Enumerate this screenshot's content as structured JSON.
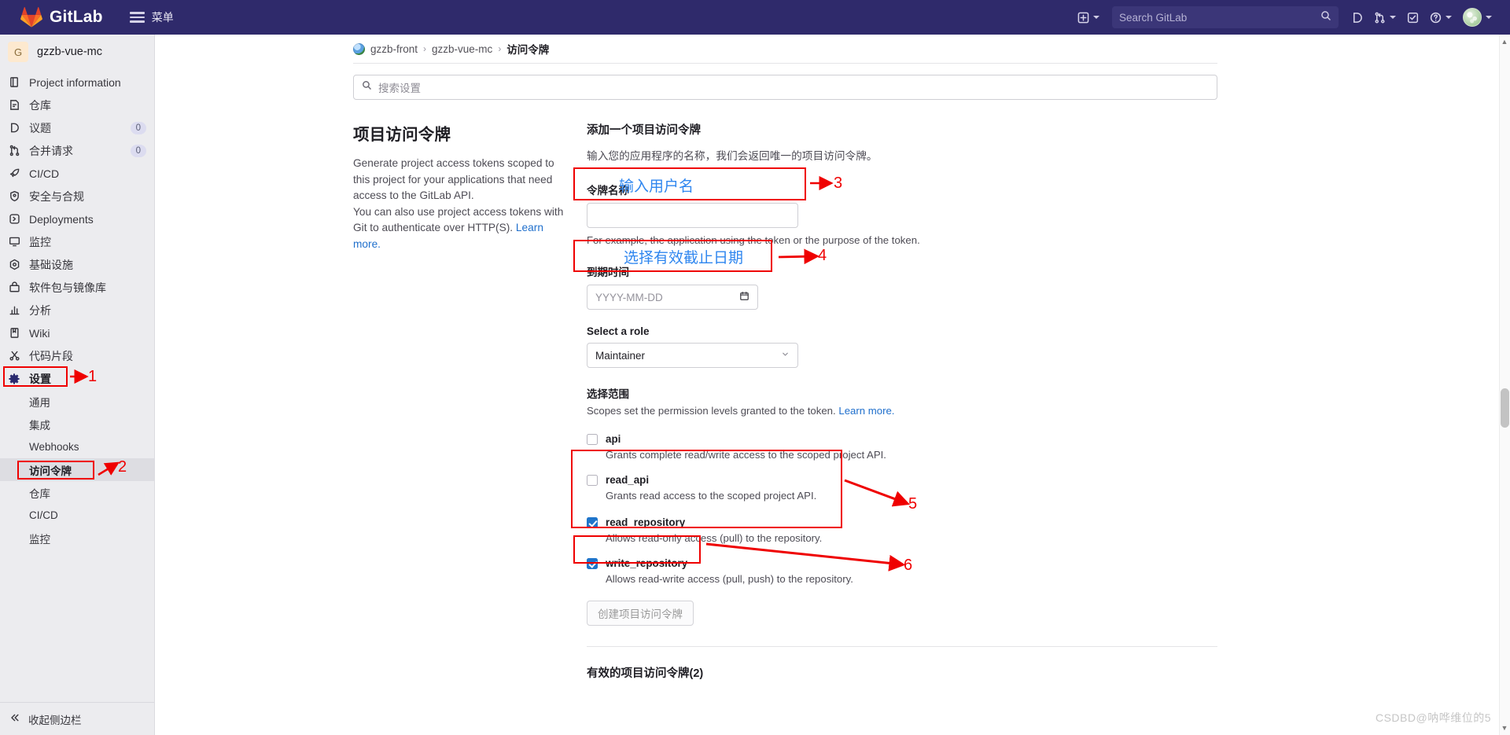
{
  "topnav": {
    "brand": "GitLab",
    "menu_label": "菜单",
    "search_placeholder": "Search GitLab",
    "icons": {
      "plus": "plus-square-icon",
      "issues": "issues-icon",
      "merge_requests": "merge-request-icon",
      "todos": "todo-icon",
      "help": "help-icon",
      "avatar": "user-avatar"
    },
    "bg_color": "#2f2a6b"
  },
  "sidebar": {
    "project": {
      "initial": "G",
      "name": "gzzb-vue-mc"
    },
    "items": [
      {
        "label": "Project information",
        "icon": "project-information-icon",
        "badge": ""
      },
      {
        "label": "仓库",
        "icon": "repository-icon",
        "badge": ""
      },
      {
        "label": "议题",
        "icon": "issues-icon",
        "badge": "0"
      },
      {
        "label": "合并请求",
        "icon": "merge-request-icon",
        "badge": "0"
      },
      {
        "label": "CI/CD",
        "icon": "rocket-icon",
        "badge": ""
      },
      {
        "label": "安全与合规",
        "icon": "shield-icon",
        "badge": ""
      },
      {
        "label": "Deployments",
        "icon": "deployments-icon",
        "badge": ""
      },
      {
        "label": "监控",
        "icon": "monitor-icon",
        "badge": ""
      },
      {
        "label": "基础设施",
        "icon": "infrastructure-icon",
        "badge": ""
      },
      {
        "label": "软件包与镜像库",
        "icon": "package-icon",
        "badge": ""
      },
      {
        "label": "分析",
        "icon": "analytics-icon",
        "badge": ""
      },
      {
        "label": "Wiki",
        "icon": "book-icon",
        "badge": ""
      },
      {
        "label": "代码片段",
        "icon": "snippet-icon",
        "badge": ""
      },
      {
        "label": "设置",
        "icon": "gear-icon",
        "badge": ""
      }
    ],
    "sub_items": [
      {
        "label": "通用",
        "active": false
      },
      {
        "label": "集成",
        "active": false
      },
      {
        "label": "Webhooks",
        "active": false
      },
      {
        "label": "访问令牌",
        "active": true
      },
      {
        "label": "仓库",
        "active": false
      },
      {
        "label": "CI/CD",
        "active": false
      },
      {
        "label": "监控",
        "active": false
      }
    ],
    "collapse_label": "收起侧边栏"
  },
  "breadcrumb": {
    "group": "gzzb-front",
    "project": "gzzb-vue-mc",
    "current": "访问令牌",
    "separator": "›"
  },
  "settings_search": {
    "placeholder": "搜索设置",
    "icon": "search-icon"
  },
  "left_panel": {
    "title": "项目访问令牌",
    "paragraph1": "Generate project access tokens scoped to this project for your applications that need access to the GitLab API.",
    "paragraph2_pre": "You can also use project access tokens with Git to authenticate over HTTP(S). ",
    "paragraph2_link": "Learn more."
  },
  "form": {
    "title": "添加一个项目访问令牌",
    "subtitle": "输入您的应用程序的名称，我们会返回唯一的项目访问令牌。",
    "name_label": "令牌名称",
    "name_value": "",
    "name_overlay": "输入用户名",
    "name_help": "For example, the application using the token or the purpose of the token.",
    "expiry_label": "到期时间",
    "expiry_placeholder": "YYYY-MM-DD",
    "expiry_overlay": "选择有效截止日期",
    "expiry_icon": "calendar-icon",
    "role_label": "Select a role",
    "role_value": "Maintainer",
    "scopes_label": "选择范围",
    "scopes_desc_pre": "Scopes set the permission levels granted to the token. ",
    "scopes_desc_link": "Learn more.",
    "scopes": [
      {
        "name": "api",
        "desc": "Grants complete read/write access to the scoped project API.",
        "checked": false
      },
      {
        "name": "read_api",
        "desc": "Grants read access to the scoped project API.",
        "checked": false
      },
      {
        "name": "read_repository",
        "desc": "Allows read-only access (pull) to the repository.",
        "checked": true
      },
      {
        "name": "write_repository",
        "desc": "Allows read-write access (pull, push) to the repository.",
        "checked": true
      }
    ],
    "submit_label": "创建项目访问令牌",
    "footer_title": "有效的项目访问令牌(2)"
  },
  "annotations": {
    "accent_color": "#ef0000",
    "markers": [
      {
        "id": "1",
        "label": "1"
      },
      {
        "id": "2",
        "label": "2"
      },
      {
        "id": "3",
        "label": "3"
      },
      {
        "id": "4",
        "label": "4"
      },
      {
        "id": "5",
        "label": "5"
      },
      {
        "id": "6",
        "label": "6"
      }
    ]
  },
  "watermark": {
    "text": "CSDBD@呐哗维位的5"
  }
}
